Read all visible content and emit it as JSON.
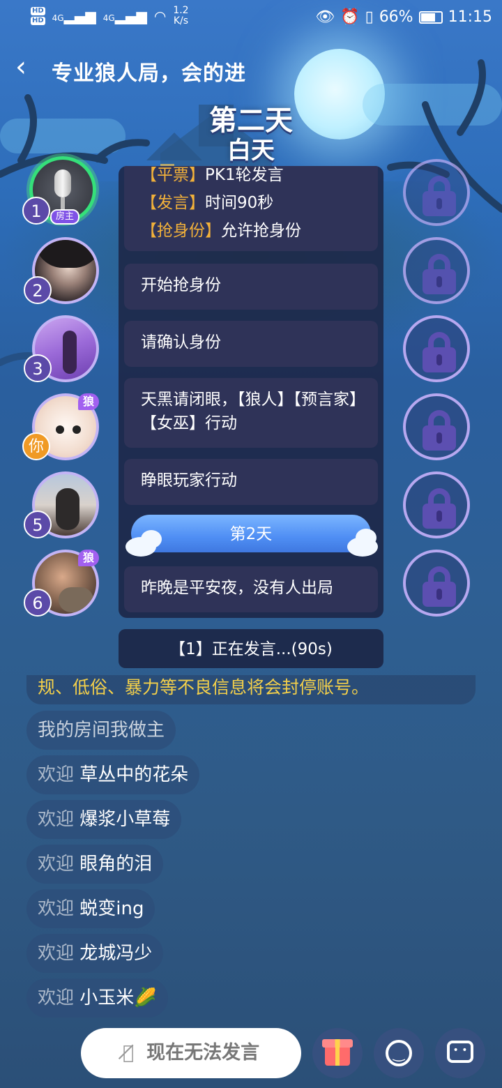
{
  "status_bar": {
    "hd1": "HD",
    "hd2": "HD",
    "sim1": "4G",
    "sim2": "4G",
    "speed_value": "1.2",
    "speed_unit": "K/s",
    "battery": "66%",
    "time": "11:15"
  },
  "header": {
    "room_title": "专业狼人局，会的进",
    "day_label": "第二天",
    "phase_label": "白天"
  },
  "log": {
    "msg1_line1_prefix": "【平票】",
    "msg1_line1_text": "PK1轮发言",
    "msg1_line2_prefix": "【发言】",
    "msg1_line2_text": "时间90秒",
    "msg1_line3_prefix": "【抢身份】",
    "msg1_line3_text": "允许抢身份",
    "msg2": "开始抢身份",
    "msg3": "请确认身份",
    "msg4": "天黑请闭眼，【狼人】【预言家】【女巫】行动",
    "msg5": "睁眼玩家行动",
    "day_banner": "第2天",
    "msg6": "昨晚是平安夜，没有人出局"
  },
  "speaking_status": "【1】正在发言...(90s)",
  "seats": [
    {
      "number": "1",
      "badge": "房主"
    },
    {
      "number": "2"
    },
    {
      "number": "3"
    },
    {
      "number": "你",
      "badge": "狼"
    },
    {
      "number": "5"
    },
    {
      "number": "6",
      "badge": "狼"
    }
  ],
  "chat": {
    "notice": "规、低俗、暴力等不良信息将会封停账号。",
    "items": [
      {
        "prefix": "",
        "text": "我的房间我做主"
      },
      {
        "prefix": "欢迎 ",
        "text": "草丛中的花朵"
      },
      {
        "prefix": "欢迎 ",
        "text": "爆浆小草莓"
      },
      {
        "prefix": "欢迎 ",
        "text": "眼角的泪"
      },
      {
        "prefix": "欢迎 ",
        "text": "蜕变ing"
      },
      {
        "prefix": "欢迎 ",
        "text": "龙城冯少"
      },
      {
        "prefix": "欢迎 ",
        "text": "小玉米🌽"
      }
    ]
  },
  "bottom_bar": {
    "speak_label": "现在无法发言",
    "mic_icon": "mic-muted-icon",
    "gift_icon": "gift-icon",
    "emoji_icon": "emoji-icon",
    "message_icon": "message-icon"
  },
  "colors": {
    "keyword": "#f2b13a",
    "host_ring": "#35e07a",
    "seat_ring": "#c3b4f5",
    "you_badge": "#f09a24",
    "notice_text": "#f4d04a"
  }
}
